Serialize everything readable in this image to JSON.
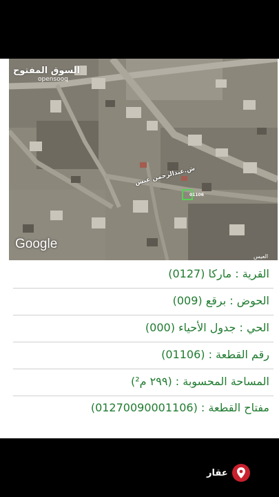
{
  "watermark": {
    "arabic": "السوق المفتوح",
    "latin": "opensooq"
  },
  "map": {
    "provider": "Google",
    "street_label": "ش.عبدالرحمن عبس",
    "parcel_label": "01106",
    "edge_label": "العيس"
  },
  "details": {
    "village": "القرية : ماركا (0127)",
    "basin": "الحوض : برقع (009)",
    "district": "الحي : جدول الأحياء (000)",
    "plot_number": "رقم القطعة : (01106)",
    "area": "المساحة المحسوبة : (٢٩٩ م²)",
    "plot_key": "مفتاح القطعة : (01270090001106)"
  },
  "footer": {
    "brand": "عقار",
    "icon": "location-pin-icon"
  },
  "colors": {
    "text_green": "#1f7b2f",
    "parcel_outline": "#58d058",
    "brand_red": "#c8202d"
  }
}
